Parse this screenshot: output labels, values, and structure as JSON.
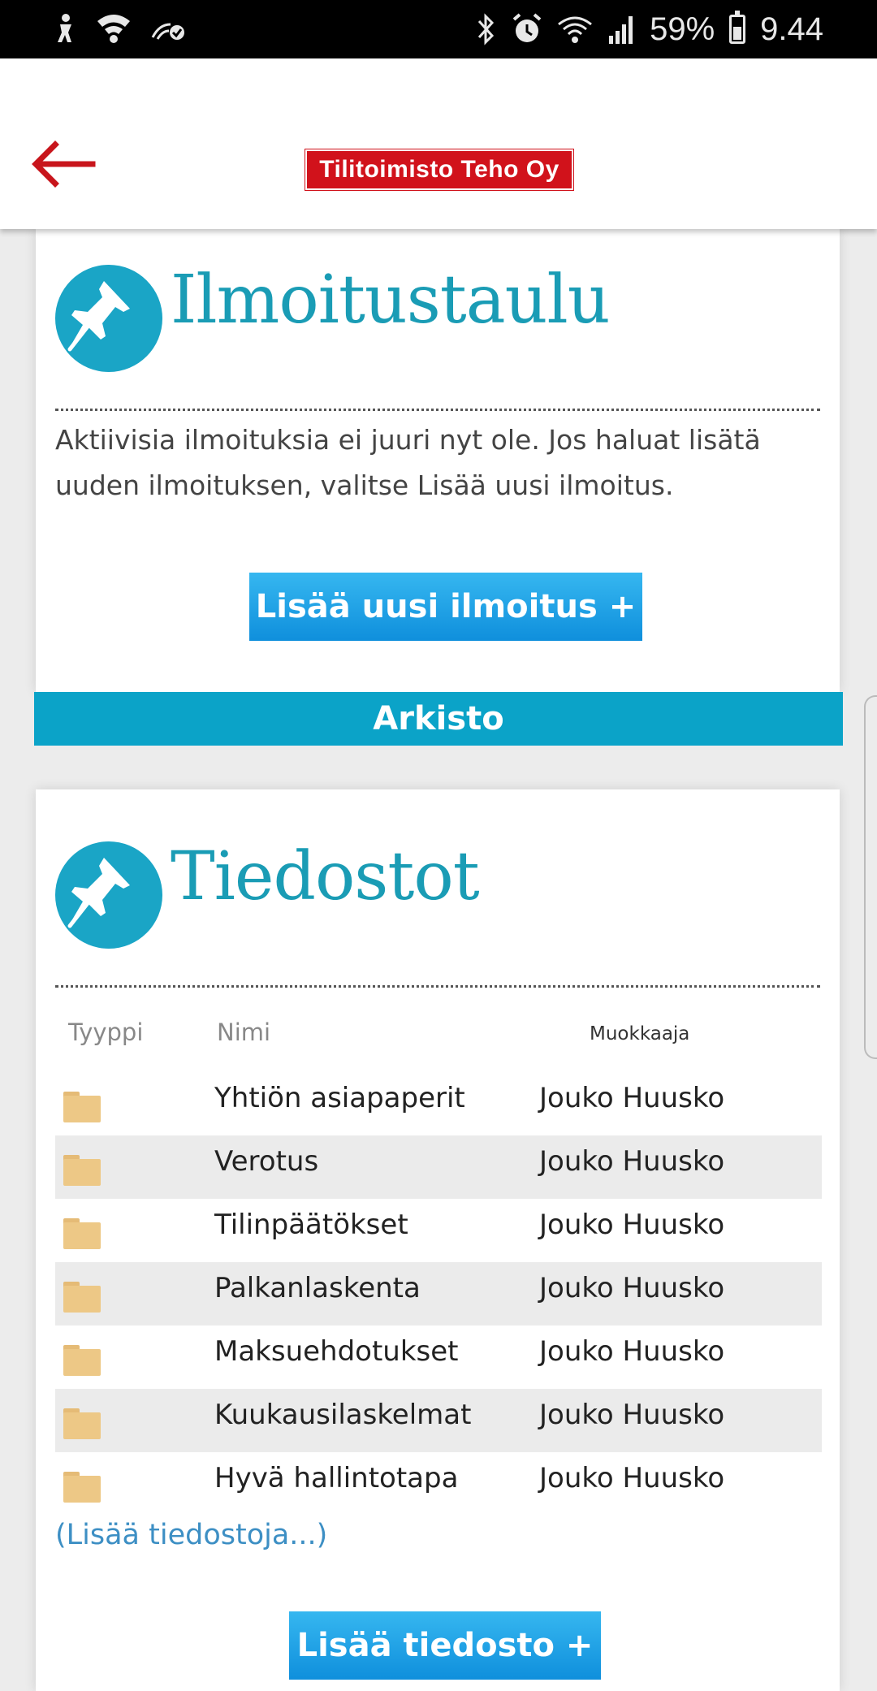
{
  "status_bar": {
    "battery": "59%",
    "time": "9.44"
  },
  "header": {
    "logo_text": "Tilitoimisto Teho Oy"
  },
  "notice_board": {
    "title": "Ilmoitustaulu",
    "message": "Aktiivisia ilmoituksia ei juuri nyt ole. Jos haluat lisätä uuden ilmoituksen, valitse Lisää uusi ilmoitus.",
    "add_button": "Lisää uusi ilmoitus +",
    "archive_button": "Arkisto"
  },
  "files": {
    "title": "Tiedostot",
    "columns": {
      "type": "Tyyppi",
      "name": "Nimi",
      "editor": "Muokkaaja"
    },
    "rows": [
      {
        "name": "Yhtiön asiapaperit",
        "editor": "Jouko Huusko"
      },
      {
        "name": "Verotus",
        "editor": "Jouko Huusko"
      },
      {
        "name": "Tilinpäätökset",
        "editor": "Jouko Huusko"
      },
      {
        "name": "Palkanlaskenta",
        "editor": "Jouko Huusko"
      },
      {
        "name": "Maksuehdotukset",
        "editor": "Jouko Huusko"
      },
      {
        "name": "Kuukausilaskelmat",
        "editor": "Jouko Huusko"
      },
      {
        "name": "Hyvä hallintotapa",
        "editor": "Jouko Huusko"
      }
    ],
    "more_link": "(Lisää tiedostoja...)",
    "add_button": "Lisää tiedosto +"
  },
  "colors": {
    "accent_teal": "#1aa5c6",
    "button_blue": "#1fa3e6",
    "logo_red": "#d1121b",
    "folder": "#edc886"
  }
}
